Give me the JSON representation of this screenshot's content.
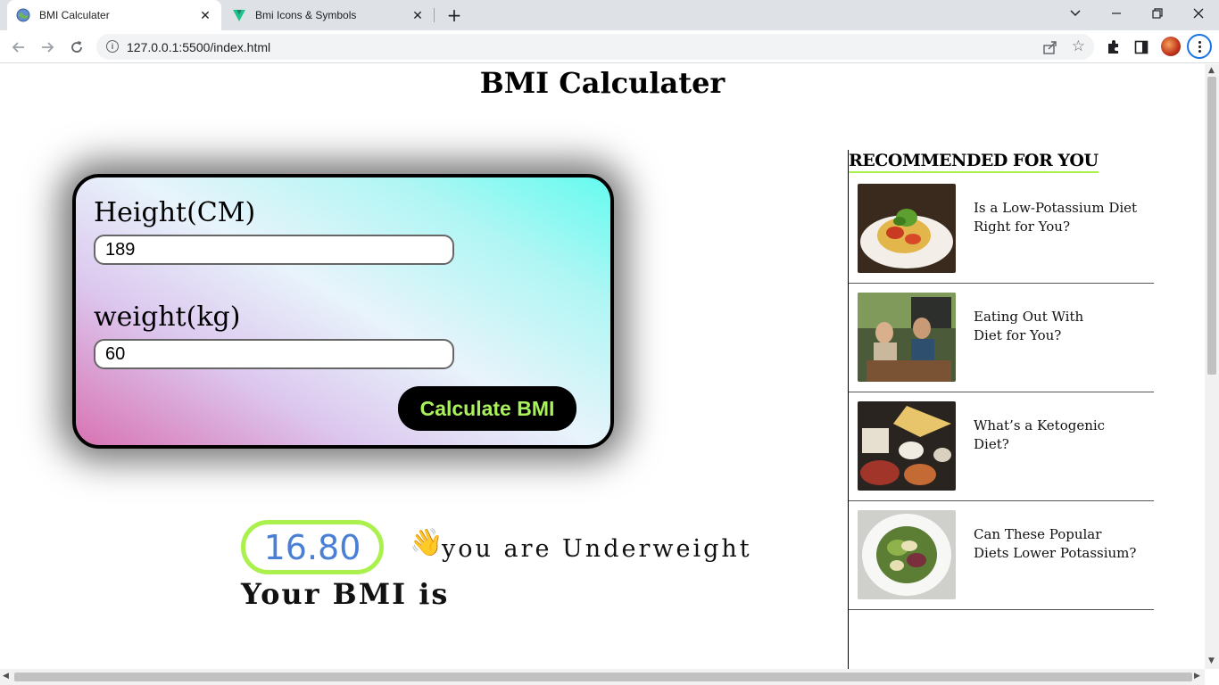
{
  "browser": {
    "tabs": [
      {
        "title": "BMI Calculater",
        "active": true,
        "icon": "globe-favicon"
      },
      {
        "title": "Bmi Icons & Symbols",
        "active": false,
        "icon": "vuetify-favicon"
      }
    ],
    "url": "127.0.0.1:5500/index.html"
  },
  "page": {
    "title": "BMI Calculater",
    "form": {
      "height_label": "Height(CM)",
      "height_value": "189",
      "weight_label": "weight(kg)",
      "weight_value": "60",
      "button_label": "Calculate BMI"
    },
    "result": {
      "bmi_value": "16.80",
      "emoji": "👋",
      "status": "you are Underweight",
      "caption": "Your BMI is"
    },
    "recommended": {
      "heading": "RECOMMENDED FOR YOU",
      "items": [
        {
          "line1": "Is a Low-Potassium Diet",
          "line2": "Right for You?"
        },
        {
          "line1": "Eating Out With",
          "line2": "Diet for You?"
        },
        {
          "line1": "What’s a Ketogenic",
          "line2": "Diet?"
        },
        {
          "line1": "Can These Popular",
          "line2": "Diets Lower Potassium?"
        }
      ]
    }
  },
  "colors": {
    "accent_green": "#aaf14d",
    "bmi_blue": "#4a7fd6",
    "button_bg": "#000000"
  }
}
